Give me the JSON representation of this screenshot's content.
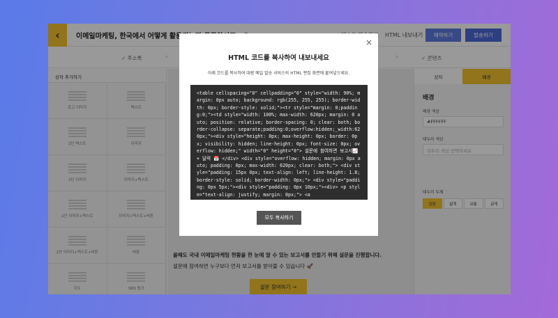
{
  "header": {
    "back_glyph": "‹",
    "title": "이메일마케팅, 한국에서 어떻게 활용되는지 궁금하시죠? 😊",
    "test_send_label": "테스트 발송하기",
    "html_export_label": "HTML 내보내기",
    "reserve_label": "예약하기",
    "send_label": "발송하기"
  },
  "steps": {
    "address": "✓ 주소록",
    "content": "✓ 콘텐츠",
    "separator": "›"
  },
  "left_panel": {
    "title": "상자 추가하기",
    "blocks": [
      {
        "label": "로고 이미지"
      },
      {
        "label": "텍스트"
      },
      {
        "label": "2단 텍스트"
      },
      {
        "label": "이미지"
      },
      {
        "label": "2단 이미지"
      },
      {
        "label": "이미지+텍스트"
      },
      {
        "label": "2단 이미지+텍스트"
      },
      {
        "label": "이미지+텍스트+버튼"
      },
      {
        "label": "2단 이미지+텍스트+버튼"
      },
      {
        "label": "버튼"
      },
      {
        "label": "지도"
      },
      {
        "label": "SNS 링크"
      }
    ]
  },
  "canvas": {
    "line1": "올해도 국내 이메일마케팅 현황을 한 눈에 알 수 있는 보고서를 만들기 위해 설문을 진행합니다.",
    "line2": "설문에 참여하면 누구보다 먼저 보고서를 받아볼 수 있습니다 🚀",
    "cta_label": "설문 참여하기 →"
  },
  "right_panel": {
    "tab_box": "상자",
    "tab_background": "배경",
    "section_title": "배경",
    "bg_color_label": "배경 색상",
    "bg_color_value": "#FFFFFF",
    "border_color_label": "테두리 색상",
    "border_color_placeholder": "테두리 색상 선택하세요",
    "border_width_label": "테두리 두께",
    "align_options": [
      "없음",
      "얇게",
      "보통",
      "굵게"
    ]
  },
  "modal": {
    "title": "HTML 코드를 복사하여 내보내세요",
    "description": "아래 코드를 복사하여 대량 메일 발송 서비스의 HTML 편집 화면에 붙여넣으세요.",
    "code": "<table cellspacing=\"0\" cellpadding=\"0\" style=\"width: 90%; margin: 0px auto; background: rgb(255, 255, 255); border-width: 0px; border-style: solid;\"><tr style=\"margin: 0;padding:0;\"><td style=\"width: 100%; max-width: 620px; margin: 0 auto; position: relative; border-spacing: 0; clear: both; border-collapse: separate;padding:0;overflow:hidden;_width:620px;\"><div style=\"height: 0px; max-height: 0px; border: 0px; visibility: hidden; line-height: 0px; font-size: 0px; overflow: hidden;\" width=\"0\" height=\"0\"> 설문에 참여하면 보고서📈 + 달력 📅 </div> <div style=\"overflow: hidden; margin: 0px auto; padding: 0px; max-width: 620px; clear: both;\"> <div style=\"padding: 15px 0px; text-align: left; line-height: 1.8; border-style: solid; border-width: 0px;\"> <div style=\"padding: 0px 5px;\"><div style=\"padding: 0px 10px;\"><div> <p style=\"text-align: justify; margin: 0px;\"> <a",
    "copy_label": "모두 복사하기",
    "close_glyph": "×"
  }
}
